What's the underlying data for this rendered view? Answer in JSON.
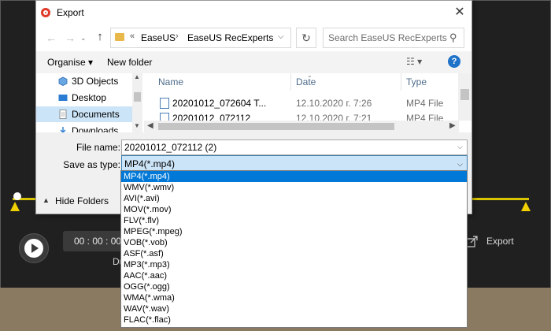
{
  "app": {
    "time": "00 : 00 : 00",
    "duration_label": "Du",
    "export_label": "Export"
  },
  "dialog": {
    "title": "Export",
    "close": "✕",
    "address": {
      "prefix": "«",
      "segments": [
        "EaseUS",
        "EaseUS RecExperts"
      ],
      "separator": "›"
    },
    "search_placeholder": "Search EaseUS RecExperts",
    "toolbar": {
      "organise": "Organise ▾",
      "new_folder": "New folder",
      "view": "☷ ▾",
      "help": "?"
    },
    "nav_items": [
      {
        "label": "3D Objects"
      },
      {
        "label": "Desktop"
      },
      {
        "label": "Documents"
      },
      {
        "label": "Downloads"
      }
    ],
    "columns": [
      "Name",
      "Date",
      "Type",
      "Si"
    ],
    "files": [
      {
        "name": "20201012_072604 T...",
        "date": "12.10.2020 г. 7:26",
        "type": "MP4 File"
      },
      {
        "name": "20201012_072112",
        "date": "12.10.2020 г. 7:21",
        "type": "MP4 File"
      }
    ],
    "file_name_label": "File name:",
    "file_name_value": "20201012_072112 (2)",
    "save_type_label": "Save as type:",
    "save_type_value": "MP4(*.mp4)",
    "hide_folders": "Hide Folders"
  },
  "dropdown": {
    "options": [
      "MP4(*.mp4)",
      "WMV(*.wmv)",
      "AVI(*.avi)",
      "MOV(*.mov)",
      "FLV(*.flv)",
      "MPEG(*.mpeg)",
      "VOB(*.vob)",
      "ASF(*.asf)",
      "MP3(*.mp3)",
      "AAC(*.aac)",
      "OGG(*.ogg)",
      "WMA(*.wma)",
      "WAV(*.wav)",
      "FLAC(*.flac)"
    ],
    "selected_index": 0
  },
  "colors": {
    "accent": "#0078d7",
    "timeline": "#d9c400",
    "selection_bg": "#cce4f7"
  }
}
